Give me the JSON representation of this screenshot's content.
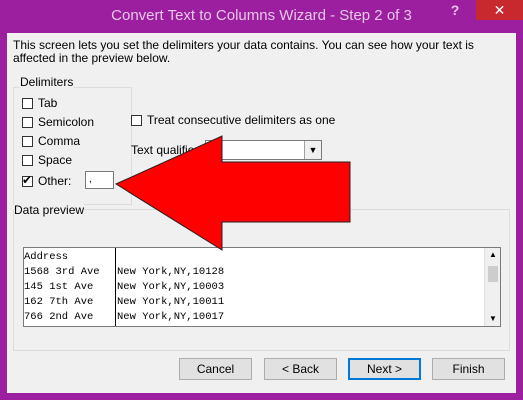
{
  "window": {
    "title": "Convert Text to Columns Wizard - Step 2 of 3",
    "help_label": "?",
    "close_label": "✕"
  },
  "intro": "This screen lets you set the delimiters your data contains.  You can see how your text is affected in the preview below.",
  "delimiters": {
    "legend": "Delimiters",
    "items": [
      {
        "label": "Tab",
        "checked": false
      },
      {
        "label": "Semicolon",
        "checked": false
      },
      {
        "label": "Comma",
        "checked": false
      },
      {
        "label": "Space",
        "checked": false
      },
      {
        "label": "Other:",
        "checked": true
      }
    ],
    "other_value": ","
  },
  "consecutive": {
    "label": "Treat consecutive delimiters as one",
    "checked": false
  },
  "qualifier": {
    "label": "Text qualifier:",
    "value": "\""
  },
  "preview": {
    "legend": "Data preview",
    "rows": [
      {
        "col1": "Address",
        "col2": ""
      },
      {
        "col1": "1568 3rd Ave",
        "col2": "New York,NY,10128"
      },
      {
        "col1": "145 1st Ave",
        "col2": "New York,NY,10003"
      },
      {
        "col1": "162 7th Ave",
        "col2": "New York,NY,10011"
      },
      {
        "col1": "766 2nd Ave",
        "col2": "New York,NY,10017"
      }
    ]
  },
  "buttons": {
    "cancel": "Cancel",
    "back": "< Back",
    "next": "Next >",
    "finish": "Finish"
  },
  "colors": {
    "title_bar": "#9b1f9e",
    "close_button": "#c7292f",
    "annotation_arrow": "#ff0000"
  }
}
